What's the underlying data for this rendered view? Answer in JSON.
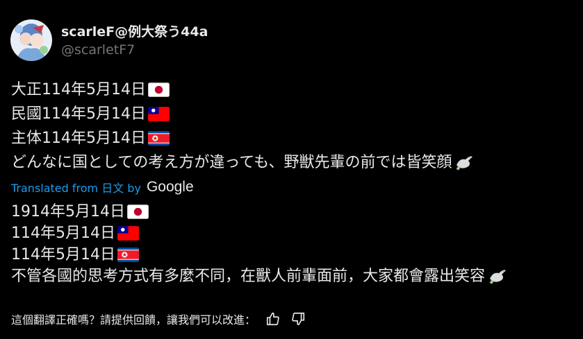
{
  "author": {
    "display_name": "scarleF@例大祭う44a",
    "handle": "@scarletF7"
  },
  "original": {
    "lines": [
      {
        "text": "大正114年5月14日",
        "flag": "japan-flag-icon"
      },
      {
        "text": "民國114年5月14日",
        "flag": "taiwan-flag-icon"
      },
      {
        "text": "主体114年5月14日",
        "flag": "north-korea-flag-icon"
      },
      {
        "text": "どんなに国としての考え方が違っても、野獣先輩の前では皆笑顔",
        "icon": "dove-icon"
      }
    ]
  },
  "translation_note": {
    "prefix": "Translated from 日文 by",
    "provider": "Google"
  },
  "translated": {
    "lines": [
      {
        "text": "1914年5月14日",
        "flag": "japan-flag-icon"
      },
      {
        "text": "114年5月14日",
        "flag": "taiwan-flag-icon"
      },
      {
        "text": "114年5月14日",
        "flag": "north-korea-flag-icon"
      },
      {
        "text": "不管各國的思考方式有多麼不同，在獸人前輩面前，大家都會露出笑容",
        "icon": "dove-icon"
      }
    ]
  },
  "feedback": {
    "prompt": "這個翻譯正確嗎？請提供回饋，讓我們可以改進：",
    "like_icon": "thumbs-up-icon",
    "dislike_icon": "thumbs-down-icon"
  },
  "colors": {
    "background": "#000000",
    "text": "#e7e9ea",
    "muted": "#71767b",
    "link": "#1d9bf0"
  }
}
